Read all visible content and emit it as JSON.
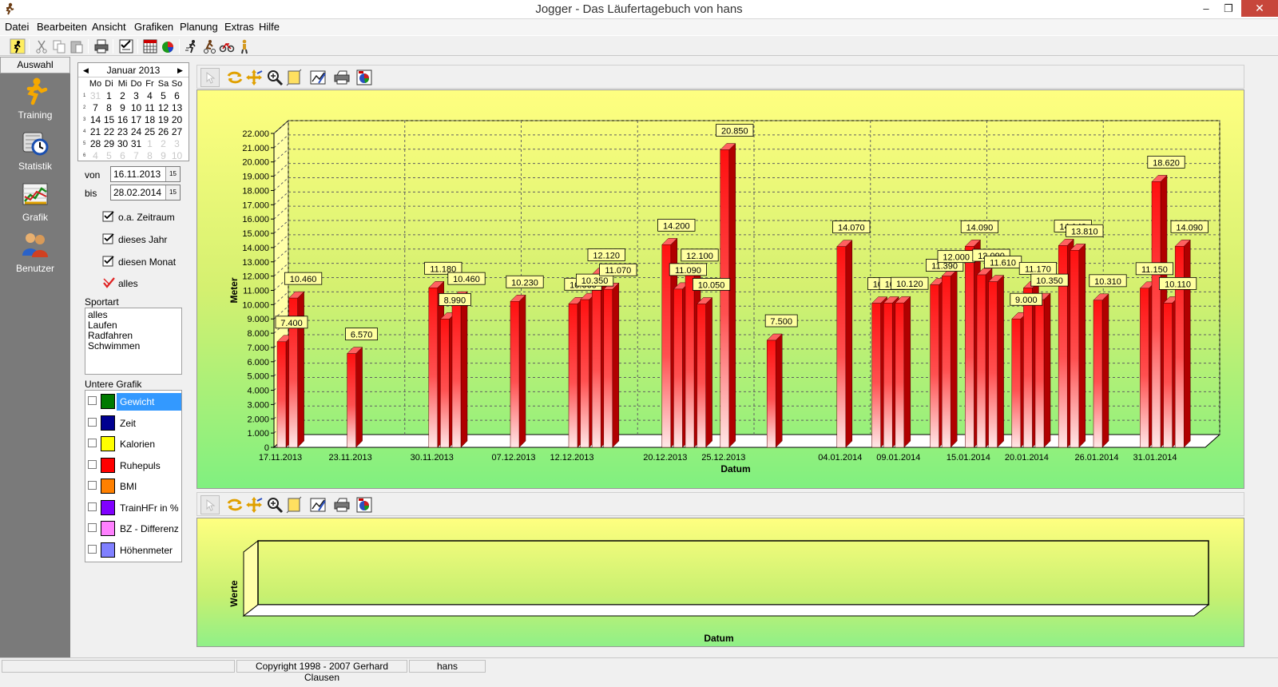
{
  "window": {
    "title": "Jogger - Das Läufertagebuch von hans",
    "buttons": {
      "minimize": "–",
      "maximize": "❐",
      "close": "✕"
    }
  },
  "menu": [
    {
      "label": "Datei"
    },
    {
      "label": "Bearbeiten"
    },
    {
      "label": "Ansicht"
    },
    {
      "label": "Grafiken"
    },
    {
      "label": "Planung"
    },
    {
      "label": "Extras"
    },
    {
      "label": "Hilfe"
    }
  ],
  "leftnav": {
    "tab": "Auswahl",
    "items": [
      {
        "label": "Training",
        "icon": "runner-icon"
      },
      {
        "label": "Statistik",
        "icon": "clock-statistik-icon"
      },
      {
        "label": "Grafik",
        "icon": "chart-icon"
      },
      {
        "label": "Benutzer",
        "icon": "users-icon"
      }
    ]
  },
  "calendar": {
    "month": "Januar 2013",
    "weekdays": [
      "Mo",
      "Di",
      "Mi",
      "Do",
      "Fr",
      "Sa",
      "So"
    ],
    "weeks": [
      {
        "wk": "1",
        "days": [
          "31",
          "1",
          "2",
          "3",
          "4",
          "5",
          "6"
        ]
      },
      {
        "wk": "2",
        "days": [
          "7",
          "8",
          "9",
          "10",
          "11",
          "12",
          "13"
        ]
      },
      {
        "wk": "3",
        "days": [
          "14",
          "15",
          "16",
          "17",
          "18",
          "19",
          "20"
        ]
      },
      {
        "wk": "4",
        "days": [
          "21",
          "22",
          "23",
          "24",
          "25",
          "26",
          "27"
        ]
      },
      {
        "wk": "5",
        "days": [
          "28",
          "29",
          "30",
          "31",
          "1",
          "2",
          "3"
        ]
      },
      {
        "wk": "6",
        "days": [
          "4",
          "5",
          "6",
          "7",
          "8",
          "9",
          "10"
        ]
      }
    ]
  },
  "range": {
    "von_label": "von",
    "von": "16.11.2013",
    "bis_label": "bis",
    "bis": "28.02.2014",
    "picker_icon": "15"
  },
  "quick": [
    {
      "label": "o.a. Zeitraum"
    },
    {
      "label": "dieses Jahr"
    },
    {
      "label": "diesen Monat"
    },
    {
      "label": "alles"
    }
  ],
  "sportart": {
    "label": "Sportart",
    "items": [
      "alles",
      "Laufen",
      "Radfahren",
      "Schwimmen"
    ]
  },
  "untere_grafik": {
    "label": "Untere Grafik",
    "items": [
      {
        "label": "Gewicht",
        "color": "#007a00",
        "selected": true
      },
      {
        "label": "Zeit",
        "color": "#000090"
      },
      {
        "label": "Kalorien",
        "color": "#ffff00"
      },
      {
        "label": "Ruhepuls",
        "color": "#ff0000"
      },
      {
        "label": "BMI",
        "color": "#ff8000"
      },
      {
        "label": "TrainHFr in %",
        "color": "#8000ff"
      },
      {
        "label": "BZ - Differenz",
        "color": "#ff80ff"
      },
      {
        "label": "Höhenmeter",
        "color": "#8080ff"
      }
    ]
  },
  "colors": {
    "bar_front": "#ff1010",
    "bar_side": "#b00000",
    "bar_top": "#ff6060",
    "panel_top": "#ffff80",
    "panel_bottom": "#80f080",
    "label_bg": "#ffffa0"
  },
  "chart_data": [
    {
      "type": "bar",
      "ylabel": "Meter",
      "xlabel": "Datum",
      "ylim": [
        0,
        22000
      ],
      "yticks": [
        "0",
        "1.000",
        "2.000",
        "3.000",
        "4.000",
        "5.000",
        "6.000",
        "7.000",
        "8.000",
        "9.000",
        "10.000",
        "11.000",
        "12.000",
        "13.000",
        "14.000",
        "15.000",
        "16.000",
        "17.000",
        "18.000",
        "19.000",
        "20.000",
        "21.000",
        "22.000"
      ],
      "xticks": [
        "17.11.2013",
        "23.11.2013",
        "30.11.2013",
        "07.12.2013",
        "12.12.2013",
        "20.12.2013",
        "25.12.2013",
        "04.01.2014",
        "09.01.2014",
        "15.01.2014",
        "20.01.2014",
        "26.01.2014",
        "31.01.2014"
      ],
      "grid": true,
      "bars": [
        {
          "date": "17.11.2013",
          "value": 7400,
          "label": "7.400"
        },
        {
          "date": "18.11.2013",
          "value": 10460,
          "label": "10.460"
        },
        {
          "date": "23.11.2013",
          "value": 6570,
          "label": "6.570"
        },
        {
          "date": "30.11.2013",
          "value": 11180,
          "label": "11.180"
        },
        {
          "date": "01.12.2013",
          "value": 8990,
          "label": "8.990"
        },
        {
          "date": "02.12.2013",
          "value": 10460,
          "label": "10.460"
        },
        {
          "date": "07.12.2013",
          "value": 10230,
          "label": "10.230"
        },
        {
          "date": "12.12.2013",
          "value": 10060,
          "label": "10.060"
        },
        {
          "date": "13.12.2013",
          "value": 10350,
          "label": "10.350"
        },
        {
          "date": "14.12.2013",
          "value": 12120,
          "label": "12.120"
        },
        {
          "date": "15.12.2013",
          "value": 11070,
          "label": "11.070"
        },
        {
          "date": "20.12.2013",
          "value": 14200,
          "label": "14.200"
        },
        {
          "date": "21.12.2013",
          "value": 11090,
          "label": "11.090"
        },
        {
          "date": "22.12.2013",
          "value": 12100,
          "label": "12.100"
        },
        {
          "date": "23.12.2013",
          "value": 10050,
          "label": "10.050"
        },
        {
          "date": "25.12.2013",
          "value": 20850,
          "label": "20.850"
        },
        {
          "date": "29.12.2013",
          "value": 7500,
          "label": "7.500"
        },
        {
          "date": "04.01.2014",
          "value": 14070,
          "label": "14.070"
        },
        {
          "date": "07.01.2014",
          "value": 10100,
          "label": "10.100"
        },
        {
          "date": "08.01.2014",
          "value": 10110,
          "label": "10.110"
        },
        {
          "date": "09.01.2014",
          "value": 10120,
          "label": "10.120"
        },
        {
          "date": "12.01.2014",
          "value": 11390,
          "label": "11.390"
        },
        {
          "date": "13.01.2014",
          "value": 12000,
          "label": "12.000"
        },
        {
          "date": "15.01.2014",
          "value": 14090,
          "label": "14.090"
        },
        {
          "date": "16.01.2014",
          "value": 12090,
          "label": "12.090"
        },
        {
          "date": "17.01.2014",
          "value": 11610,
          "label": "11.610"
        },
        {
          "date": "19.01.2014",
          "value": 9000,
          "label": "9.000"
        },
        {
          "date": "20.01.2014",
          "value": 11170,
          "label": "11.170"
        },
        {
          "date": "21.01.2014",
          "value": 10350,
          "label": "10.350"
        },
        {
          "date": "23.01.2014",
          "value": 14140,
          "label": "14.140"
        },
        {
          "date": "24.01.2014",
          "value": 13810,
          "label": "13.810"
        },
        {
          "date": "26.01.2014",
          "value": 10310,
          "label": "10.310"
        },
        {
          "date": "30.01.2014",
          "value": 11150,
          "label": "11.150"
        },
        {
          "date": "31.01.2014",
          "value": 18620,
          "label": "18.620"
        },
        {
          "date": "01.02.2014",
          "value": 10110,
          "label": "10.110"
        },
        {
          "date": "02.02.2014",
          "value": 14090,
          "label": "14.090"
        }
      ]
    },
    {
      "type": "bar",
      "ylabel": "Werte",
      "xlabel": "Datum",
      "bars": []
    }
  ],
  "status": {
    "copyright": "Copyright 1998 - 2007 Gerhard Clausen",
    "user": "hans"
  }
}
